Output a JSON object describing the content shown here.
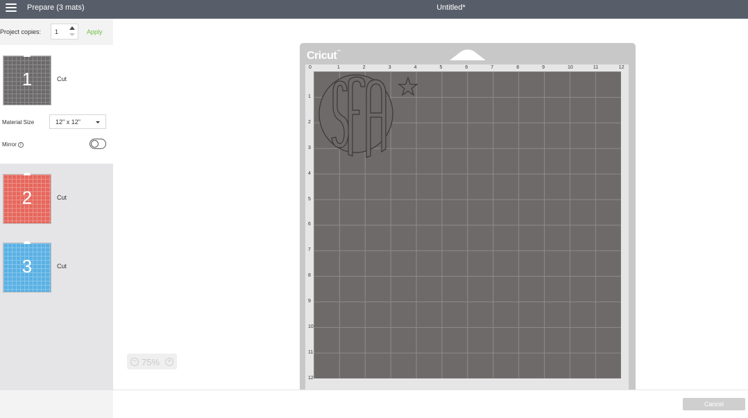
{
  "header": {
    "menu_icon": "hamburger-menu-icon",
    "prepare_title": "Prepare (3 mats)",
    "document_title": "Untitled*"
  },
  "sidebar": {
    "copies_label": "Project copies:",
    "copies_value": "1",
    "apply_label": "Apply",
    "mats": [
      {
        "number": "1",
        "label": "Cut",
        "color": "#6c6a6a"
      },
      {
        "number": "2",
        "label": "Cut",
        "color": "#e5675d"
      },
      {
        "number": "3",
        "label": "Cut",
        "color": "#5ab0e3"
      }
    ],
    "material_size_label": "Material Size",
    "material_size_value": "12\" x 12\"",
    "mirror_label": "Mirror",
    "mirror_enabled": false
  },
  "canvas": {
    "brand": "Cricut",
    "ruler_top": [
      "0",
      "1",
      "2",
      "3",
      "4",
      "5",
      "6",
      "7",
      "8",
      "9",
      "10",
      "11",
      "12"
    ],
    "ruler_left": [
      "1",
      "2",
      "3",
      "4",
      "5",
      "6",
      "7",
      "8",
      "9",
      "10",
      "11",
      "12"
    ],
    "zoom_value": "75%",
    "design_items": [
      "monogram-SFA",
      "star"
    ]
  },
  "footer": {
    "cancel_label": "Cancel"
  }
}
